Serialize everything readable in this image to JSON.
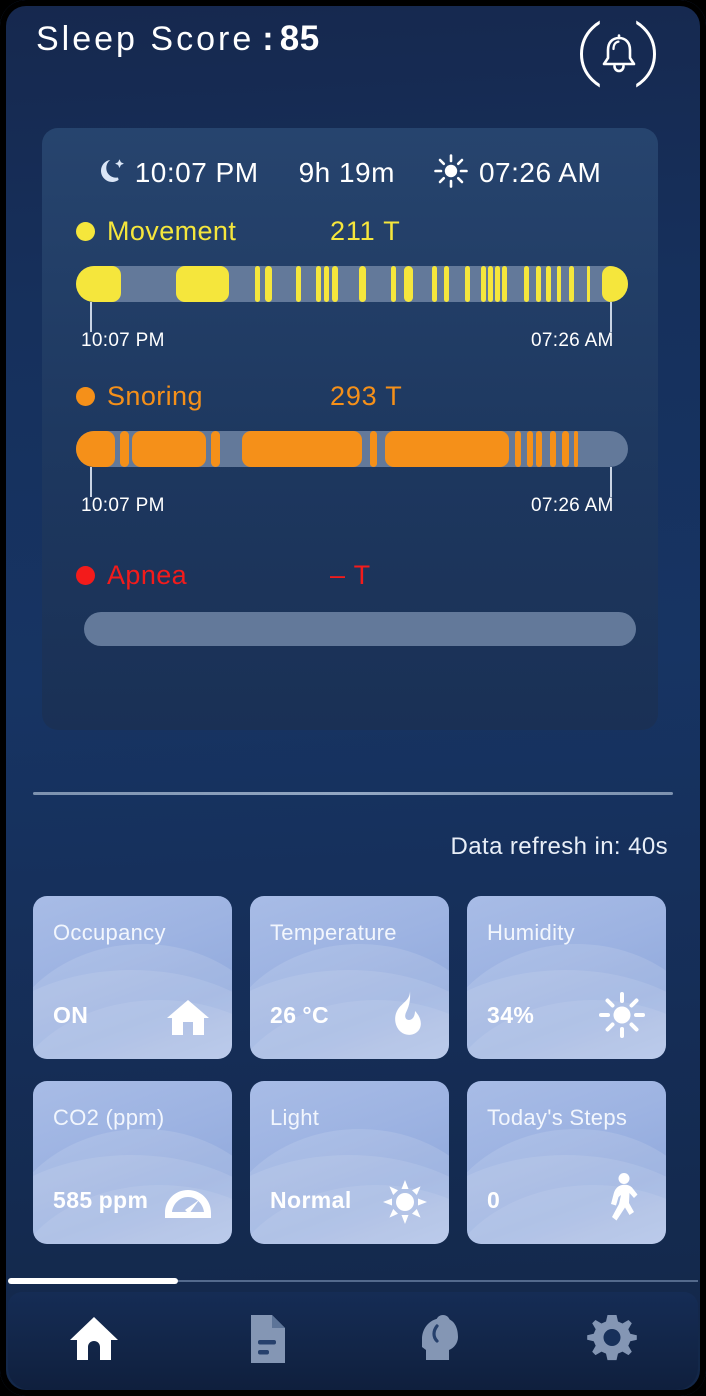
{
  "header": {
    "score_label": "Sleep Score",
    "colon": ":",
    "score_value": "85",
    "bell_icon": "bell-icon"
  },
  "sleep_card": {
    "bedtime": "10:07 PM",
    "duration": "9h 19m",
    "waketime": "07:26 AM",
    "moon_icon": "moon-icon",
    "sun_icon": "sun-icon"
  },
  "metrics": [
    {
      "name": "Movement",
      "count": "211 T",
      "color": "#f5e63c",
      "start_label": "10:07 PM",
      "end_label": "07:26 AM",
      "segments": [
        {
          "x": 0.0,
          "w": 0.082
        },
        {
          "x": 0.182,
          "w": 0.095
        },
        {
          "x": 0.325,
          "w": 0.009
        },
        {
          "x": 0.342,
          "w": 0.013
        },
        {
          "x": 0.398,
          "w": 0.009
        },
        {
          "x": 0.434,
          "w": 0.009
        },
        {
          "x": 0.449,
          "w": 0.009
        },
        {
          "x": 0.463,
          "w": 0.011
        },
        {
          "x": 0.513,
          "w": 0.013
        },
        {
          "x": 0.571,
          "w": 0.009
        },
        {
          "x": 0.594,
          "w": 0.016
        },
        {
          "x": 0.645,
          "w": 0.009
        },
        {
          "x": 0.666,
          "w": 0.009
        },
        {
          "x": 0.705,
          "w": 0.009
        },
        {
          "x": 0.733,
          "w": 0.009
        },
        {
          "x": 0.746,
          "w": 0.009
        },
        {
          "x": 0.759,
          "w": 0.009
        },
        {
          "x": 0.772,
          "w": 0.009
        },
        {
          "x": 0.812,
          "w": 0.009
        },
        {
          "x": 0.833,
          "w": 0.009
        },
        {
          "x": 0.851,
          "w": 0.009
        },
        {
          "x": 0.872,
          "w": 0.007
        },
        {
          "x": 0.893,
          "w": 0.009
        },
        {
          "x": 0.925,
          "w": 0.007
        },
        {
          "x": 0.952,
          "w": 0.048
        }
      ]
    },
    {
      "name": "Snoring",
      "count": "293 T",
      "color": "#f59019",
      "start_label": "10:07 PM",
      "end_label": "07:26 AM",
      "segments": [
        {
          "x": 0.0,
          "w": 0.07
        },
        {
          "x": 0.08,
          "w": 0.016
        },
        {
          "x": 0.102,
          "w": 0.134
        },
        {
          "x": 0.245,
          "w": 0.016
        },
        {
          "x": 0.3,
          "w": 0.218
        },
        {
          "x": 0.532,
          "w": 0.014
        },
        {
          "x": 0.56,
          "w": 0.224
        },
        {
          "x": 0.795,
          "w": 0.012
        },
        {
          "x": 0.817,
          "w": 0.011
        },
        {
          "x": 0.834,
          "w": 0.01
        },
        {
          "x": 0.858,
          "w": 0.011
        },
        {
          "x": 0.88,
          "w": 0.013
        },
        {
          "x": 0.903,
          "w": 0.007
        }
      ]
    },
    {
      "name": "Apnea",
      "count": "–  T",
      "color": "#f31b1b",
      "start_label": "",
      "end_label": "",
      "segments": []
    }
  ],
  "refresh": {
    "label": "Data refresh in:",
    "value": "40s"
  },
  "sensors": [
    {
      "title": "Occupancy",
      "value": "ON",
      "unit": "",
      "icon": "home-icon"
    },
    {
      "title": "Temperature",
      "value": "26",
      "unit": "°C",
      "icon": "flame-icon"
    },
    {
      "title": "Humidity",
      "value": "34%",
      "unit": "",
      "icon": "sun-icon"
    },
    {
      "title": "CO2 (ppm)",
      "value": "585",
      "unit": "ppm",
      "icon": "gauge-icon"
    },
    {
      "title": "Light",
      "value": "Normal",
      "unit": "",
      "icon": "brightness-icon"
    },
    {
      "title": "Today's Steps",
      "value": "0",
      "unit": "",
      "icon": "walking-icon"
    }
  ],
  "nav": [
    {
      "name": "home-icon",
      "active": true
    },
    {
      "name": "report-icon",
      "active": false
    },
    {
      "name": "head-sensor-icon",
      "active": false
    },
    {
      "name": "gear-icon",
      "active": false
    }
  ],
  "colors": {
    "movement": "#f5e63c",
    "snoring": "#f59019",
    "apnea": "#f31b1b",
    "track": "#63799a",
    "card_bg": "#9db3e2"
  }
}
